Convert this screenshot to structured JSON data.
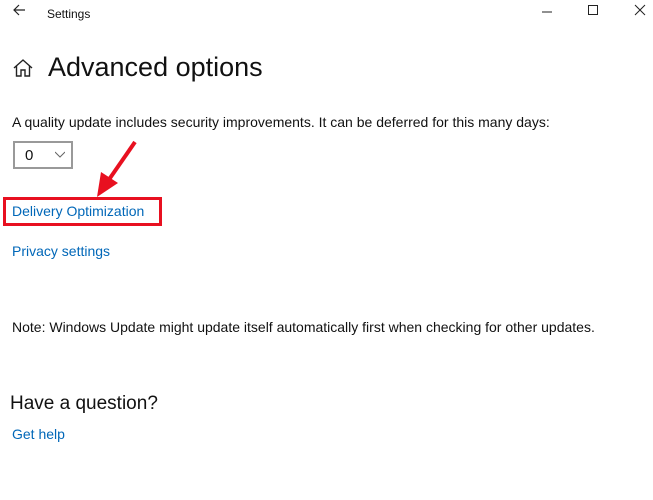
{
  "window": {
    "title": "Settings",
    "back_icon": "arrow-left-icon",
    "controls": {
      "minimize_glyph": "—",
      "maximize_glyph": "☐",
      "close_glyph": "✕"
    }
  },
  "page": {
    "icon": "home-icon",
    "title": "Advanced options"
  },
  "deferral": {
    "description": "A quality update includes security improvements. It can be deferred for this many days:",
    "selected_value": "0"
  },
  "links": {
    "delivery_optimization": "Delivery Optimization",
    "privacy_settings": "Privacy settings"
  },
  "note": "Note: Windows Update might update itself automatically first when checking for other updates.",
  "question": {
    "heading": "Have a question?",
    "get_help": "Get help"
  },
  "annotation": {
    "color": "#e81020",
    "target": "Delivery Optimization"
  }
}
